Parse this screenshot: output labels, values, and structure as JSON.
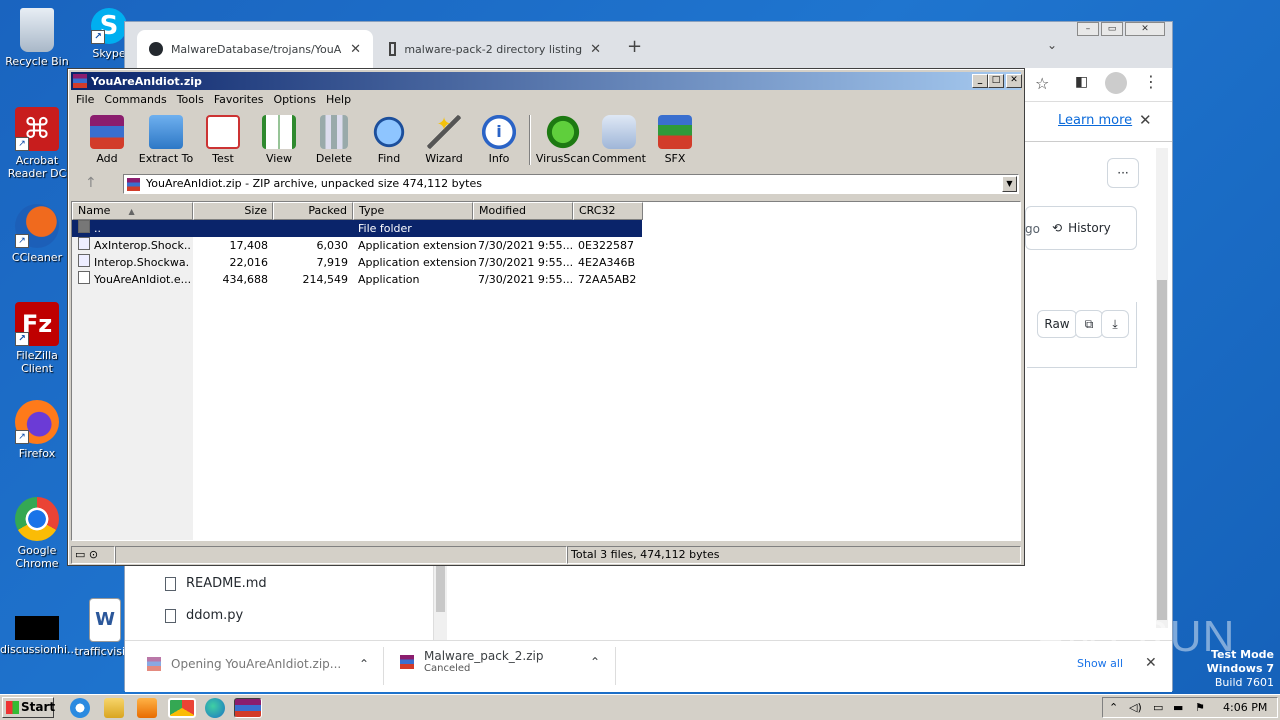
{
  "desktop": {
    "icons": [
      {
        "label": "Recycle Bin",
        "icon": "recycle-bin-icon"
      },
      {
        "label": "Skype",
        "icon": "skype-icon"
      },
      {
        "label": "Acrobat Reader DC",
        "icon": "acrobat-icon"
      },
      {
        "label": "CCleaner",
        "icon": "ccleaner-icon"
      },
      {
        "label": "FileZilla Client",
        "icon": "filezilla-icon"
      },
      {
        "label": "Firefox",
        "icon": "firefox-icon"
      },
      {
        "label": "Google Chrome",
        "icon": "chrome-icon"
      },
      {
        "label": "discussionhi...",
        "icon": "blank-file-icon"
      },
      {
        "label": "trafficvisi...",
        "icon": "word-doc-icon"
      }
    ]
  },
  "browser": {
    "tabs": [
      {
        "title": "MalwareDatabase/trojans/YouAreA",
        "icon": "github-icon"
      },
      {
        "title": "malware-pack-2 directory listing",
        "icon": "page-icon"
      }
    ],
    "new_tab": "+",
    "learn_more": "Learn more",
    "history": "History",
    "more": "···",
    "raw": "Raw",
    "partial_text": "go",
    "files": [
      "README.md",
      "ddom.py"
    ],
    "downloads": [
      {
        "name": "Opening YouAreAnIdiot.zip...",
        "sub": ""
      },
      {
        "name": "Malware_pack_2.zip",
        "sub": "Canceled"
      }
    ],
    "show_all": "Show all"
  },
  "winrar": {
    "title": "YouAreAnIdiot.zip",
    "menu": [
      "File",
      "Commands",
      "Tools",
      "Favorites",
      "Options",
      "Help"
    ],
    "tools": [
      "Add",
      "Extract To",
      "Test",
      "View",
      "Delete",
      "Find",
      "Wizard",
      "Info",
      "VirusScan",
      "Comment",
      "SFX"
    ],
    "address": "YouAreAnIdiot.zip - ZIP archive, unpacked size 474,112 bytes",
    "columns": [
      "Name",
      "Size",
      "Packed",
      "Type",
      "Modified",
      "CRC32"
    ],
    "rows": [
      {
        "name": "..",
        "size": "",
        "packed": "",
        "type": "File folder",
        "modified": "",
        "crc": ""
      },
      {
        "name": "AxInterop.Shock...",
        "size": "17,408",
        "packed": "6,030",
        "type": "Application extension",
        "modified": "7/30/2021 9:55...",
        "crc": "0E322587"
      },
      {
        "name": "Interop.Shockwa...",
        "size": "22,016",
        "packed": "7,919",
        "type": "Application extension",
        "modified": "7/30/2021 9:55...",
        "crc": "4E2A346B"
      },
      {
        "name": "YouAreAnIdiot.e...",
        "size": "434,688",
        "packed": "214,549",
        "type": "Application",
        "modified": "7/30/2021 9:55...",
        "crc": "72AA5AB2"
      }
    ],
    "status": "Total 3 files, 474,112 bytes"
  },
  "taskbar": {
    "start": "Start",
    "time": "4:06 PM"
  },
  "os_overlay": {
    "watermark": "ANY.RUN",
    "line1": "Test Mode",
    "line2": "Windows 7",
    "line3": "Build 7601"
  },
  "colors": {
    "desktop": "#1f6fc9",
    "rar_title": "#0a246a",
    "selection": "#0a246a",
    "link": "#0969da"
  }
}
